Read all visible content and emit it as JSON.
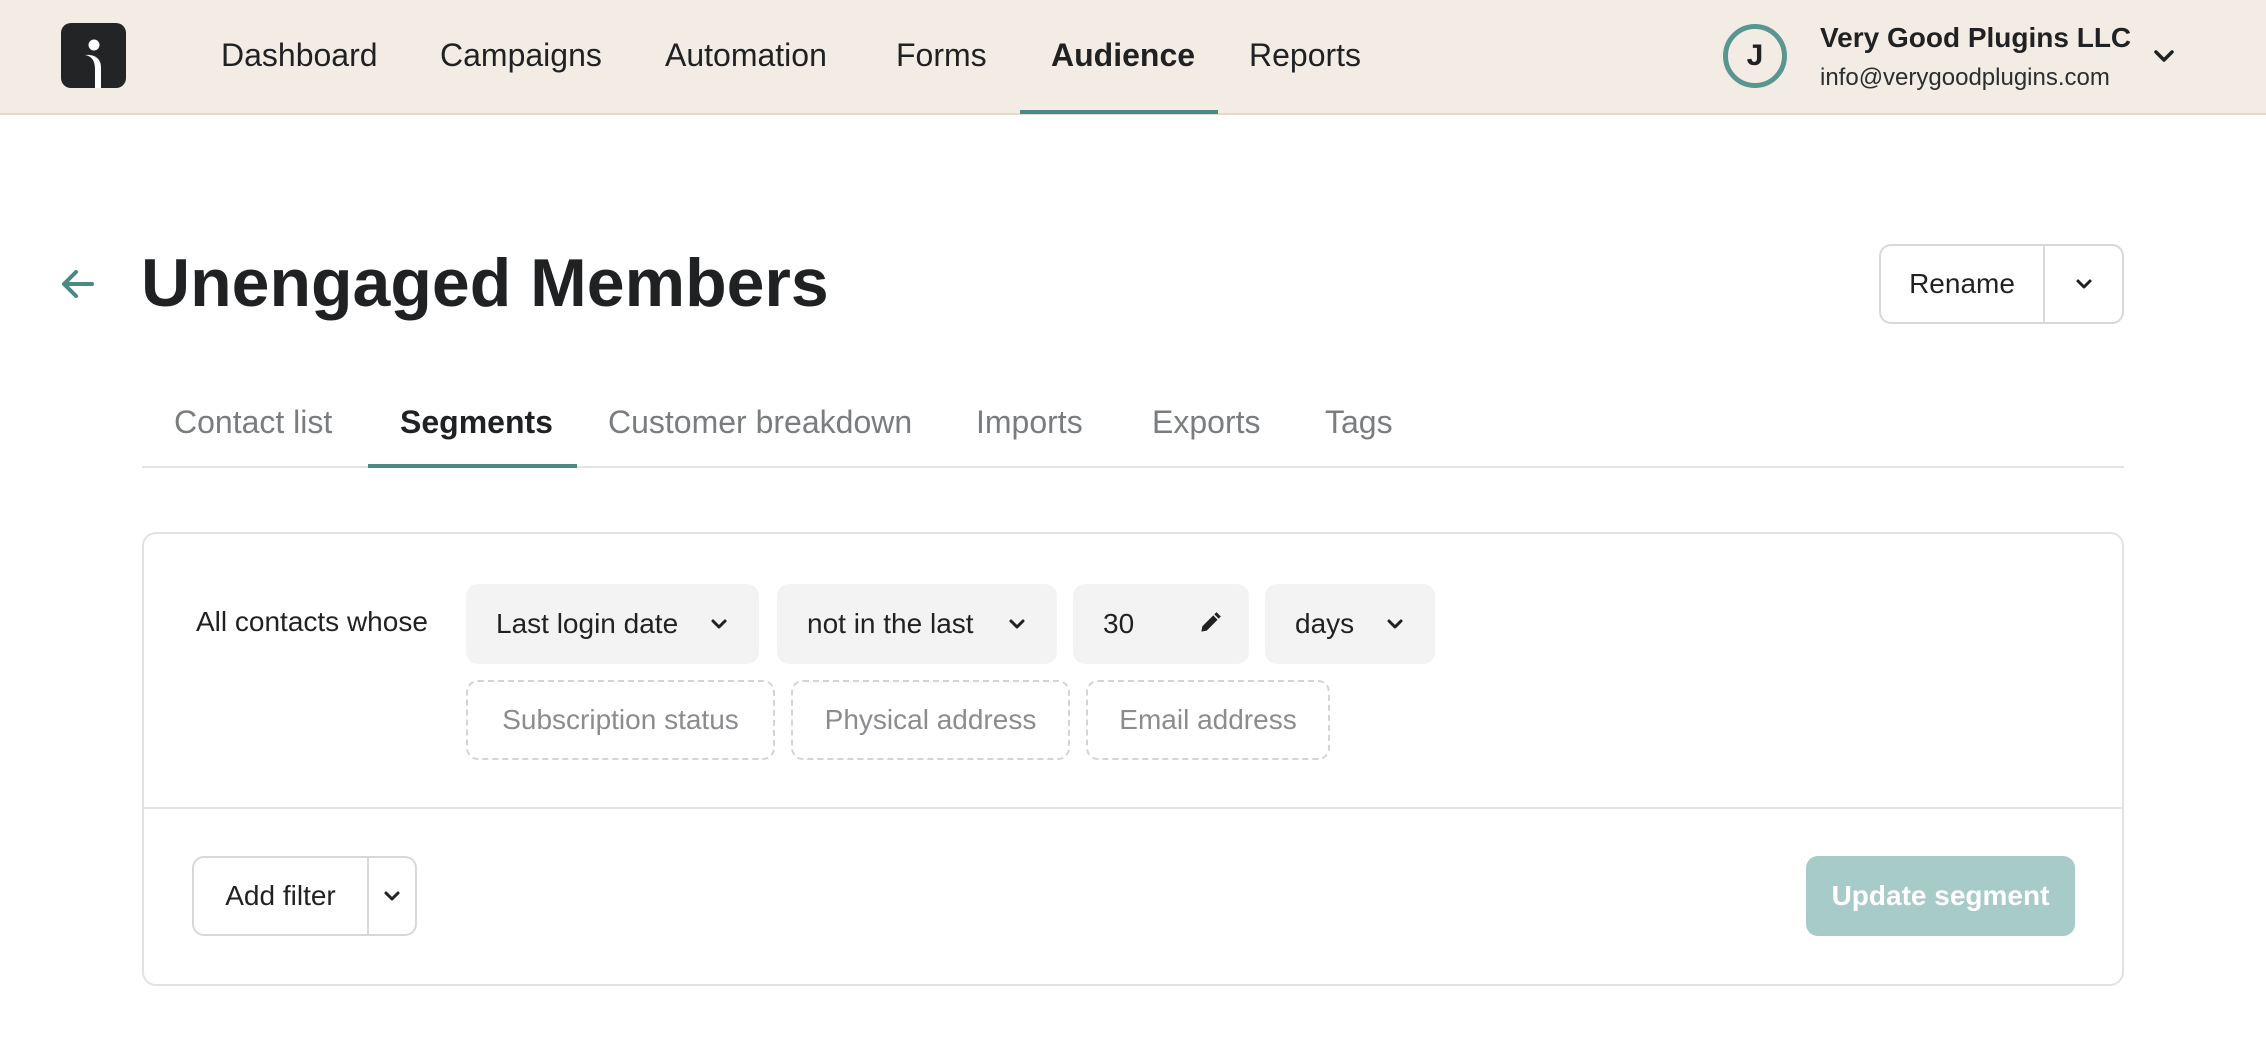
{
  "nav": {
    "items": [
      {
        "label": "Dashboard"
      },
      {
        "label": "Campaigns"
      },
      {
        "label": "Automation"
      },
      {
        "label": "Forms"
      },
      {
        "label": "Audience",
        "active": true
      },
      {
        "label": "Reports"
      }
    ]
  },
  "account": {
    "initial": "J",
    "name": "Very Good Plugins LLC",
    "email": "info@verygoodplugins.com"
  },
  "page": {
    "title": "Unengaged Members",
    "rename_label": "Rename"
  },
  "subtabs": [
    {
      "label": "Contact list"
    },
    {
      "label": "Segments",
      "active": true
    },
    {
      "label": "Customer breakdown"
    },
    {
      "label": "Imports"
    },
    {
      "label": "Exports"
    },
    {
      "label": "Tags"
    }
  ],
  "segment": {
    "rule_prefix": "All contacts whose",
    "field": "Last login date",
    "operator": "not in the last",
    "value": "30",
    "unit": "days",
    "suggestions": [
      "Subscription status",
      "Physical address",
      "Email address"
    ],
    "add_filter_label": "Add filter",
    "update_label": "Update segment"
  },
  "colors": {
    "accent": "#4a8a84",
    "topbar_bg": "#f3ece4",
    "update_button_disabled": "#a6cbc8"
  },
  "icons": {
    "logo": "brand-logo-icon",
    "account_menu": "chevron-down-icon",
    "back": "arrow-left-icon",
    "edit_value": "pencil-icon"
  }
}
